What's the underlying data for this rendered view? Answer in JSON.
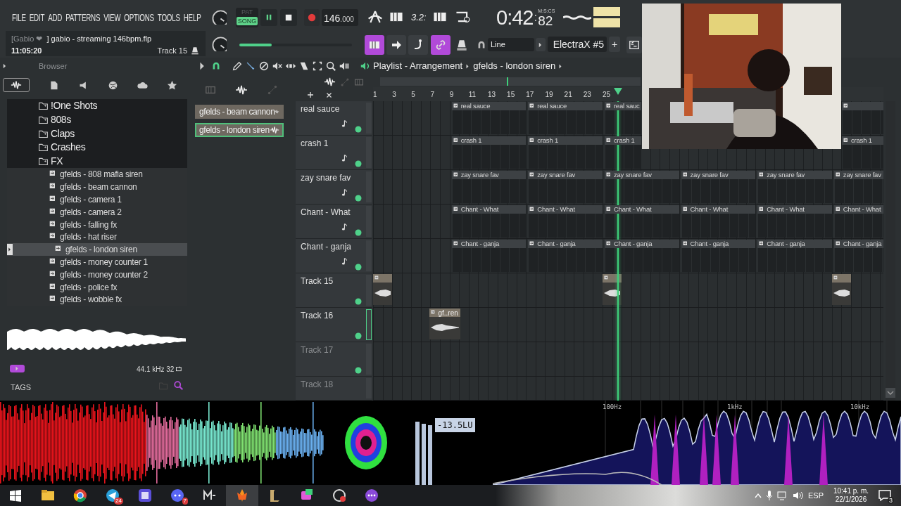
{
  "menu": [
    "FILE",
    "EDIT",
    "ADD",
    "PATTERNS",
    "VIEW",
    "OPTIONS",
    "TOOLS",
    "HELP"
  ],
  "hint_bar": {
    "user": "[Gabio ❤",
    "file": "] gabio - streaming 146bpm.flp",
    "clock": "11:05:20",
    "track": "Track 15"
  },
  "transport": {
    "pat_label": "PAT",
    "song_label": "SONG",
    "song_mode": true,
    "playing": true,
    "tempo_int": "146",
    "tempo_frac": ".000",
    "time_sig": "3.2:",
    "time": "0:42",
    "time_sep": ":",
    "time_cs": "82",
    "time_unit": "M:S:CS"
  },
  "song_position": {
    "level": 0.29
  },
  "snap": "Line",
  "pattern": {
    "name": "ElectraX #5",
    "add": "+"
  },
  "browser": {
    "title": "Browser",
    "tree": [
      {
        "label": "!One Shots",
        "kind": "folder",
        "selected": false
      },
      {
        "label": "808s",
        "kind": "folder",
        "selected": false
      },
      {
        "label": "Claps",
        "kind": "folder",
        "selected": false
      },
      {
        "label": "Crashes",
        "kind": "folder",
        "selected": false
      },
      {
        "label": "FX",
        "kind": "folder",
        "selected": false,
        "children": [
          {
            "label": "gfelds - 808 mafia siren",
            "kind": "file",
            "selected": false
          },
          {
            "label": "gfelds - beam cannon",
            "kind": "file",
            "selected": false
          },
          {
            "label": "gfelds - camera 1",
            "kind": "file",
            "selected": false
          },
          {
            "label": "gfelds - camera 2",
            "kind": "file",
            "selected": false
          },
          {
            "label": "gfelds - falling fx",
            "kind": "file",
            "selected": false
          },
          {
            "label": "gfelds - hat riser",
            "kind": "file",
            "selected": false
          },
          {
            "label": "gfelds - london siren",
            "kind": "file",
            "selected": true
          },
          {
            "label": "gfelds - money counter 1",
            "kind": "file",
            "selected": false
          },
          {
            "label": "gfelds - money counter 2",
            "kind": "file",
            "selected": false
          },
          {
            "label": "gfelds - police fx",
            "kind": "file",
            "selected": false
          },
          {
            "label": "gfelds - wobble fx",
            "kind": "file",
            "selected": false
          }
        ]
      }
    ],
    "sample_info": "44.1 kHz 32",
    "tags_label": "TAGS"
  },
  "clip_source": [
    {
      "label": "gfelds - beam cannon",
      "selected": false
    },
    {
      "label": "gfelds - london siren",
      "selected": true
    }
  ],
  "playlist": {
    "title": "Playlist - Arrangement",
    "pattern": "gfelds - london siren",
    "ruler": [
      "1",
      "3",
      "5",
      "7",
      "9",
      "11",
      "13",
      "15",
      "17",
      "19",
      "21",
      "23",
      "25"
    ],
    "playhead": {
      "level": 0.479
    },
    "tracks": [
      {
        "name": "real sauce",
        "kind": "pattern",
        "enabled": true,
        "selected": false,
        "slots": [
          {
            "kind": "none"
          },
          {
            "kind": "pattern",
            "label": "real sauce"
          },
          {
            "kind": "pattern",
            "label": "real sauce"
          },
          {
            "kind": "pattern",
            "label": "real sauc"
          },
          {
            "kind": "none"
          },
          {
            "kind": "none"
          },
          {
            "kind": "pattern"
          }
        ]
      },
      {
        "name": "crash 1",
        "kind": "pattern",
        "enabled": true,
        "selected": false,
        "slots": [
          {
            "kind": "none"
          },
          {
            "kind": "pattern",
            "label": "crash 1"
          },
          {
            "kind": "pattern",
            "label": "crash 1"
          },
          {
            "kind": "pattern",
            "label": "crash 1"
          },
          {
            "kind": "none"
          },
          {
            "kind": "none"
          },
          {
            "kind": "pattern",
            "label": "crash 1"
          }
        ]
      },
      {
        "name": "zay snare fav",
        "kind": "pattern",
        "enabled": true,
        "selected": false,
        "slots": [
          {
            "kind": "none"
          },
          {
            "kind": "pattern",
            "label": "zay snare fav"
          },
          {
            "kind": "pattern",
            "label": "zay snare fav"
          },
          {
            "kind": "pattern",
            "label": "zay snare fav"
          },
          {
            "kind": "pattern",
            "label": "zay snare fav"
          },
          {
            "kind": "pattern",
            "label": "zay snare fav"
          },
          {
            "kind": "pattern",
            "label": "zay snare fav"
          }
        ]
      },
      {
        "name": "Chant - What",
        "kind": "pattern",
        "enabled": true,
        "selected": false,
        "slots": [
          {
            "kind": "none"
          },
          {
            "kind": "pattern",
            "label": "Chant - What"
          },
          {
            "kind": "pattern",
            "label": "Chant - What"
          },
          {
            "kind": "pattern",
            "label": "Chant - What"
          },
          {
            "kind": "pattern",
            "label": "Chant - What"
          },
          {
            "kind": "pattern",
            "label": "Chant - What"
          },
          {
            "kind": "pattern",
            "label": "Chant - What"
          }
        ]
      },
      {
        "name": "Chant - ganja",
        "kind": "pattern",
        "enabled": true,
        "selected": false,
        "slots": [
          {
            "kind": "none"
          },
          {
            "kind": "pattern",
            "label": "Chant - ganja"
          },
          {
            "kind": "pattern",
            "label": "Chant - ganja"
          },
          {
            "kind": "pattern",
            "label": "Chant - ganja"
          },
          {
            "kind": "pattern",
            "label": "Chant - ganja"
          },
          {
            "kind": "pattern",
            "label": "Chant - ganja"
          },
          {
            "kind": "pattern",
            "label": "Chant - ganja"
          }
        ]
      },
      {
        "name": "Track 15",
        "kind": "audio",
        "enabled": true,
        "selected": false,
        "slots": [
          {
            "kind": "audio"
          },
          {
            "kind": "none"
          },
          {
            "kind": "none"
          },
          {
            "kind": "audio"
          },
          {
            "kind": "none"
          },
          {
            "kind": "none"
          },
          {
            "kind": "audio"
          }
        ]
      },
      {
        "name": "Track 16",
        "kind": "audio",
        "enabled": true,
        "selected": true,
        "slots": [
          {
            "kind": "lateaudio",
            "label": "gf..ren"
          }
        ]
      },
      {
        "name": "Track 17",
        "kind": "empty",
        "enabled": true,
        "selected": false
      },
      {
        "name": "Track 18",
        "kind": "empty",
        "selected": false
      }
    ]
  },
  "meters": {
    "loudness": "-13.5LU",
    "freq_labels": [
      "100Hz",
      "1kHz",
      "10kHz"
    ]
  },
  "webcam": {
    "kind": "picture"
  },
  "taskbar": {
    "apps": [
      {
        "kind": "explorer",
        "selected": false
      },
      {
        "kind": "chrome",
        "selected": false
      },
      {
        "kind": "telegram",
        "badge": "24",
        "selected": false
      },
      {
        "kind": "opgg",
        "selected": false
      },
      {
        "kind": "chat",
        "badge": "7",
        "selected": false
      },
      {
        "kind": "m",
        "selected": false
      },
      {
        "kind": "fl",
        "selected": true
      },
      {
        "kind": "league",
        "selected": false
      },
      {
        "kind": "game",
        "selected": false
      },
      {
        "kind": "record",
        "selected": false
      },
      {
        "kind": "bubble",
        "selected": false
      }
    ],
    "language": "ESP",
    "time": "10:41 p. m.",
    "date": "22/1/2026",
    "notifications": "3"
  }
}
